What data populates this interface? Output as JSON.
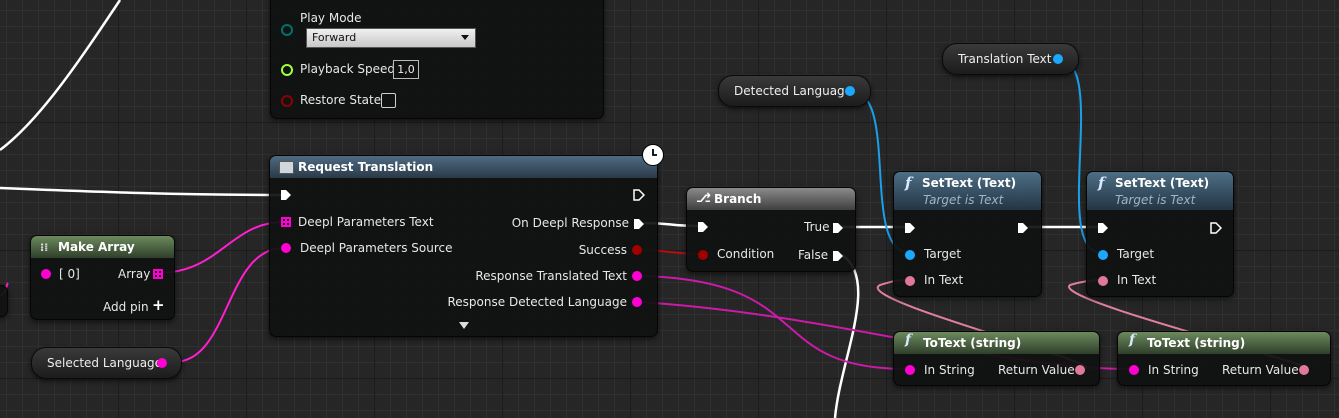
{
  "timeline_node": {
    "play_mode_label": "Play Mode",
    "play_mode_value": "Forward",
    "playback_speed_label": "Playback Speed",
    "playback_speed_value": "1,0",
    "restore_state_label": "Restore State"
  },
  "request_translation": {
    "title": "Request Translation",
    "inputs": [
      "Deepl Parameters Text",
      "Deepl Parameters Source"
    ],
    "outputs": [
      "On Deepl Response",
      "Success",
      "Response Translated Text",
      "Response Detected Language"
    ]
  },
  "make_array": {
    "title": "Make Array",
    "input": "[ 0]",
    "output": "Array",
    "add_pin": "Add pin"
  },
  "selected_language": {
    "label": "Selected Language"
  },
  "detected_language": {
    "label": "Detected Language"
  },
  "translation_text": {
    "label": "Translation Text"
  },
  "branch": {
    "title": "Branch",
    "condition": "Condition",
    "true_label": "True",
    "false_label": "False"
  },
  "settext_1": {
    "title": "SetText (Text)",
    "subtitle": "Target is Text",
    "target": "Target",
    "in_text": "In Text"
  },
  "settext_2": {
    "title": "SetText (Text)",
    "subtitle": "Target is Text",
    "target": "Target",
    "in_text": "In Text"
  },
  "totext_1": {
    "title": "ToText (string)",
    "in_string": "In String",
    "return_value": "Return Value"
  },
  "totext_2": {
    "title": "ToText (string)",
    "in_string": "In String",
    "return_value": "Return Value"
  },
  "colors": {
    "exec": "#ffffff",
    "string_pin": "#ff00d4",
    "object_pin": "#1ba8ff",
    "text_pin": "#e0789a",
    "bool_pin": "#8f0000",
    "float_pin": "#a3ff3c",
    "enum_pin": "#00716b"
  }
}
